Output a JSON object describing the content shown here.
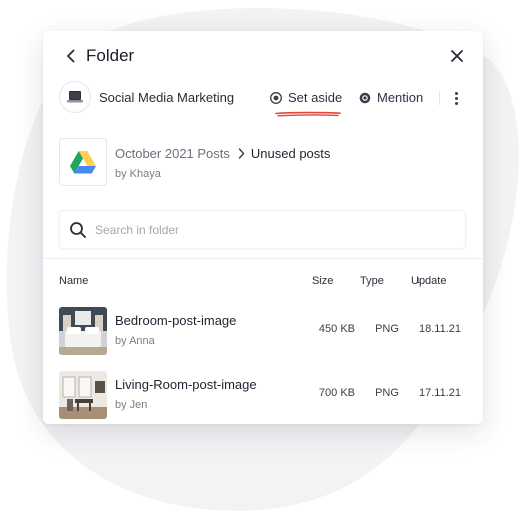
{
  "header": {
    "title": "Folder",
    "back_icon": "chevron-left-icon",
    "close_icon": "close-icon"
  },
  "context": {
    "name": "Social Media Marketing",
    "thumb_icon": "laptop-icon",
    "actions": [
      {
        "label": "Set aside",
        "icon": "set-aside-icon"
      },
      {
        "label": "Mention",
        "icon": "at-sign-icon"
      }
    ],
    "more_icon": "more-vertical-icon"
  },
  "folder": {
    "icon": "google-drive-icon",
    "parent": "October 2021 Posts",
    "current": "Unused posts",
    "owner": "by Khaya"
  },
  "search": {
    "placeholder": "Search in folder",
    "value": ""
  },
  "table": {
    "columns": [
      "Name",
      "Size",
      "Type",
      "Update"
    ],
    "sort_indicator": "↓",
    "sorted_by": "Update",
    "rows": [
      {
        "name": "Bedroom-post-image",
        "by": "by Anna",
        "size": "450 KB",
        "type": "PNG",
        "updated": "18.11.21"
      },
      {
        "name": "Living-Room-post-image",
        "by": "by Jen",
        "size": "700 KB",
        "type": "PNG",
        "updated": "17.11.21"
      }
    ]
  },
  "colors": {
    "accent_underline": "#e0473e",
    "drive_green": "#1fa463",
    "drive_yellow": "#ffd04b",
    "drive_blue": "#4688f1",
    "background_blob": "#f3f3f5"
  }
}
